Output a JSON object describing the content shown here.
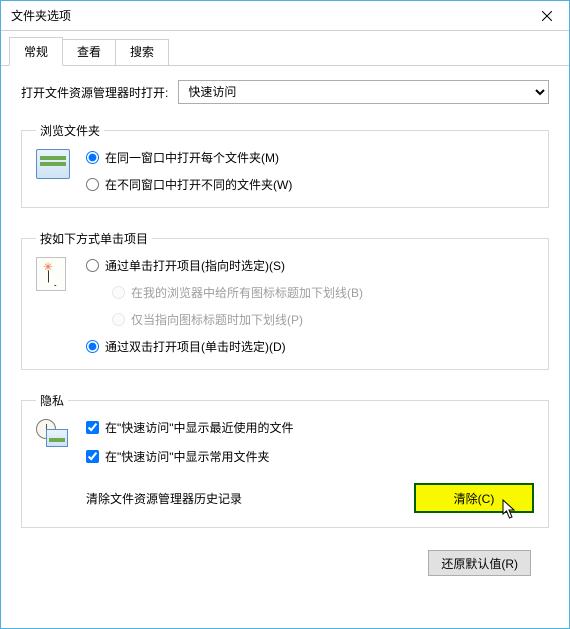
{
  "window": {
    "title": "文件夹选项"
  },
  "tabs": {
    "general": "常规",
    "view": "查看",
    "search": "搜索"
  },
  "open_in": {
    "label": "打开文件资源管理器时打开:",
    "value": "快速访问"
  },
  "browse": {
    "legend": "浏览文件夹",
    "same_window": "在同一窗口中打开每个文件夹(M)",
    "new_window": "在不同窗口中打开不同的文件夹(W)"
  },
  "click": {
    "legend": "按如下方式单击项目",
    "single": "通过单击打开项目(指向时选定)(S)",
    "underline_all": "在我的浏览器中给所有图标标题加下划线(B)",
    "underline_point": "仅当指向图标标题时加下划线(P)",
    "double": "通过双击打开项目(单击时选定)(D)"
  },
  "privacy": {
    "legend": "隐私",
    "recent_files": "在\"快速访问\"中显示最近使用的文件",
    "frequent_folders": "在\"快速访问\"中显示常用文件夹",
    "clear_label": "清除文件资源管理器历史记录",
    "clear_button": "清除(C)"
  },
  "footer": {
    "restore": "还原默认值(R)"
  }
}
